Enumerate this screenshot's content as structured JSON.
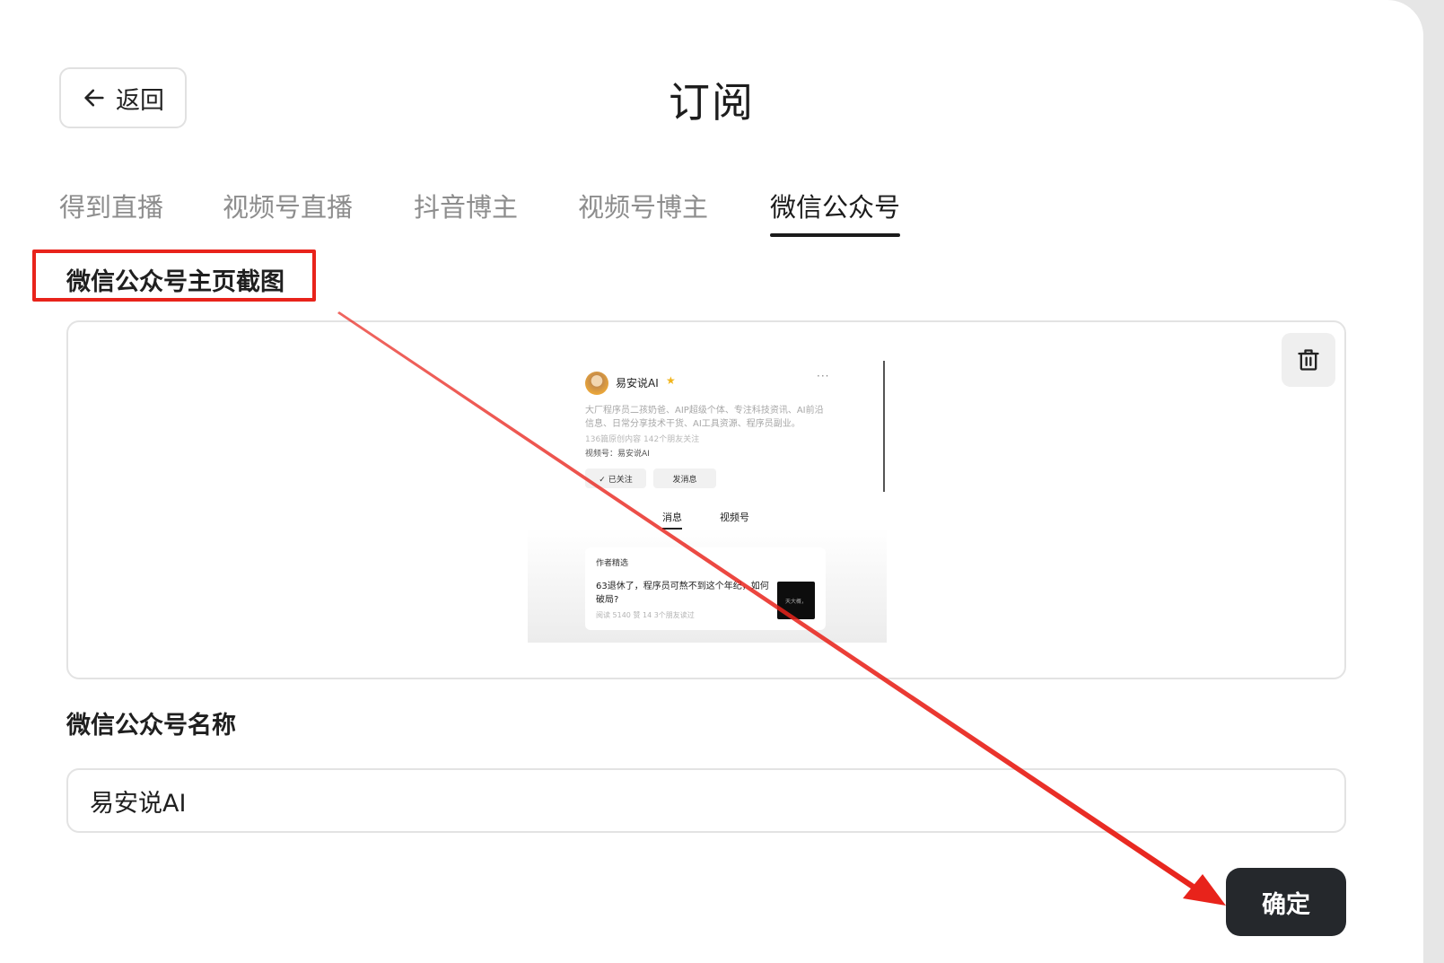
{
  "header": {
    "back_label": "返回",
    "title": "订阅"
  },
  "tabs": [
    {
      "label": "得到直播",
      "active": false
    },
    {
      "label": "视频号直播",
      "active": false
    },
    {
      "label": "抖音博主",
      "active": false
    },
    {
      "label": "视频号博主",
      "active": false
    },
    {
      "label": "微信公众号",
      "active": true
    }
  ],
  "screenshot_section": {
    "label": "微信公众号主页截图",
    "thumbnail": {
      "account_name": "易安说AI",
      "description": "大厂程序员二孩奶爸、AIP超级个体、专注科技资讯、AI前沿信息、日常分享技术干货、AI工具资源、程序员副业。",
      "stats": "136篇原创内容  142个朋友关注",
      "video_account": "视频号：易安说AI",
      "followed_label": "✓ 已关注",
      "message_label": "发消息",
      "tab_messages": "消息",
      "tab_video": "视频号",
      "card_title": "作者精选",
      "card_text": "63退休了，程序员可熬不到这个年纪，如何破局?",
      "card_meta": "阅读 5140  赞 14  3个朋友读过",
      "card_image_text": "天大概，"
    }
  },
  "name_section": {
    "label": "微信公众号名称",
    "value": "易安说AI"
  },
  "confirm_label": "确定",
  "colors": {
    "accent_dark": "#25282c",
    "annotation_red": "#e8231b",
    "tab_inactive": "#8d8d8d"
  },
  "icons": {
    "back": "arrow-left-icon",
    "delete": "trash-icon"
  }
}
